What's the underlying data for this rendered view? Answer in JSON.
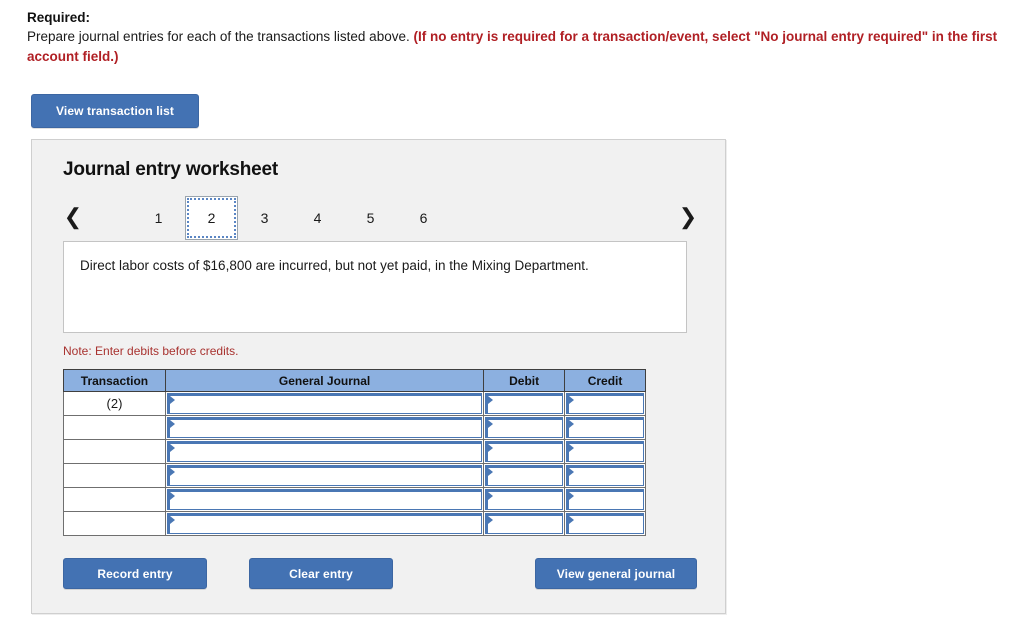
{
  "required": {
    "label": "Required:",
    "instruction": "Prepare journal entries for each of the transactions listed above.",
    "emphasis": "(If no entry is required for a transaction/event, select \"No journal entry required\" in the first account field.)"
  },
  "toolbar": {
    "view_transaction_list_label": "View transaction list"
  },
  "worksheet": {
    "title": "Journal entry worksheet",
    "nav": {
      "prev_icon": "chevron-left-icon",
      "next_icon": "chevron-right-icon",
      "prev_glyph": "❮",
      "next_glyph": "❯"
    },
    "tabs": [
      {
        "label": "1",
        "selected": false
      },
      {
        "label": "2",
        "selected": true
      },
      {
        "label": "3",
        "selected": false
      },
      {
        "label": "4",
        "selected": false
      },
      {
        "label": "5",
        "selected": false
      },
      {
        "label": "6",
        "selected": false
      }
    ],
    "transaction_description": "Direct labor costs of $16,800 are incurred, but not yet paid, in the Mixing Department.",
    "note": "Note: Enter debits before credits.",
    "table": {
      "columns": [
        "Transaction",
        "General Journal",
        "Debit",
        "Credit"
      ],
      "rows": [
        {
          "transaction": "(2)",
          "general_journal": "",
          "debit": "",
          "credit": ""
        },
        {
          "transaction": "",
          "general_journal": "",
          "debit": "",
          "credit": ""
        },
        {
          "transaction": "",
          "general_journal": "",
          "debit": "",
          "credit": ""
        },
        {
          "transaction": "",
          "general_journal": "",
          "debit": "",
          "credit": ""
        },
        {
          "transaction": "",
          "general_journal": "",
          "debit": "",
          "credit": ""
        },
        {
          "transaction": "",
          "general_journal": "",
          "debit": "",
          "credit": ""
        }
      ]
    },
    "actions": {
      "record_entry_label": "Record entry",
      "clear_entry_label": "Clear entry",
      "view_general_journal_label": "View general journal"
    }
  },
  "colors": {
    "button_blue": "#4372b3",
    "table_header_blue": "#8cb0e0",
    "input_border_blue": "#4a77b4",
    "emphasis_red": "#b01f24",
    "note_red": "#a8322f",
    "panel_gray": "#f1f1f1"
  }
}
